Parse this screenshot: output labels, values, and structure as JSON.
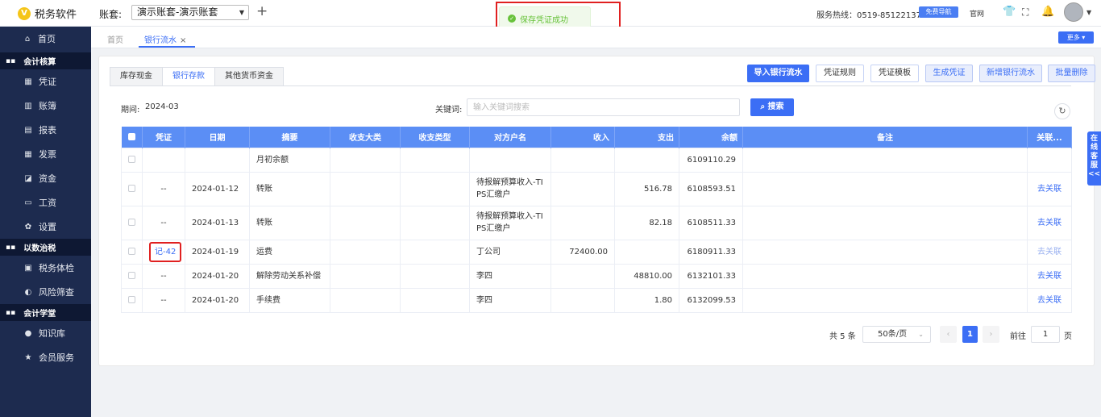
{
  "app": {
    "name": "税务软件",
    "logo_letter": "V"
  },
  "account": {
    "label": "账套:",
    "selected": "演示账套-演示账套"
  },
  "toast": {
    "message": "保存凭证成功"
  },
  "header": {
    "hotline": "服务热线：0519-85122137",
    "free_nav_label": "免费导航",
    "website_label": "官网"
  },
  "sidebar": {
    "items": [
      {
        "type": "item",
        "label": "首页",
        "icon": "home-icon",
        "glyph": "⌂"
      },
      {
        "type": "group",
        "label": "会计核算",
        "icon": "grid-icon",
        "glyph": "▪▪"
      },
      {
        "type": "item",
        "label": "凭证",
        "icon": "voucher-icon",
        "glyph": "▦"
      },
      {
        "type": "item",
        "label": "账簿",
        "icon": "ledger-icon",
        "glyph": "▥"
      },
      {
        "type": "item",
        "label": "报表",
        "icon": "report-icon",
        "glyph": "▤"
      },
      {
        "type": "item",
        "label": "发票",
        "icon": "invoice-icon",
        "glyph": "▦"
      },
      {
        "type": "item",
        "label": "资金",
        "icon": "fund-icon",
        "glyph": "◪"
      },
      {
        "type": "item",
        "label": "工资",
        "icon": "salary-icon",
        "glyph": "▭"
      },
      {
        "type": "item",
        "label": "设置",
        "icon": "settings-icon",
        "glyph": "✿"
      },
      {
        "type": "group",
        "label": "以数治税",
        "icon": "grid-icon",
        "glyph": "▪▪"
      },
      {
        "type": "item",
        "label": "税务体检",
        "icon": "tax-check-icon",
        "glyph": "▣"
      },
      {
        "type": "item",
        "label": "风险筛查",
        "icon": "risk-icon",
        "glyph": "◐"
      },
      {
        "type": "group",
        "label": "会计学堂",
        "icon": "grid-icon",
        "glyph": "▪▪"
      },
      {
        "type": "item",
        "label": "知识库",
        "icon": "knowledge-icon",
        "glyph": "●"
      },
      {
        "type": "item",
        "label": "会员服务",
        "icon": "member-icon",
        "glyph": "★"
      }
    ]
  },
  "tabs": {
    "home": "首页",
    "current": "银行流水",
    "more": "更多"
  },
  "subtabs": [
    "库存现金",
    "银行存款",
    "其他货币资金"
  ],
  "actions": {
    "import": "导入银行流水",
    "voucher_rules": "凭证规则",
    "voucher_template": "凭证模板",
    "generate": "生成凭证",
    "add_bank": "新增银行流水",
    "batch_delete": "批量删除"
  },
  "filters": {
    "period_label": "期间:",
    "period": "2024-03",
    "keyword_label": "关键词:",
    "keyword_placeholder": "输入关键词搜索",
    "search_label": "搜索"
  },
  "table": {
    "columns": [
      "凭证",
      "日期",
      "摘要",
      "收支大类",
      "收支类型",
      "对方户名",
      "收入",
      "支出",
      "余额",
      "备注",
      "关联..."
    ],
    "rows": [
      {
        "voucher": "",
        "date": "",
        "summary": "月初余额",
        "major": "",
        "type": "",
        "party": "",
        "income": "",
        "expense": "",
        "balance": "6109110.29",
        "remark": "",
        "link": ""
      },
      {
        "voucher": "--",
        "date": "2024-01-12",
        "summary": "转账",
        "major": "",
        "type": "",
        "party": "待报解预算收入-TIPS汇缴户",
        "income": "",
        "expense": "516.78",
        "balance": "6108593.51",
        "remark": "",
        "link": "去关联"
      },
      {
        "voucher": "--",
        "date": "2024-01-13",
        "summary": "转账",
        "major": "",
        "type": "",
        "party": "待报解预算收入-TIPS汇缴户",
        "income": "",
        "expense": "82.18",
        "balance": "6108511.33",
        "remark": "",
        "link": "去关联"
      },
      {
        "voucher": "记-42",
        "date": "2024-01-19",
        "summary": "运费",
        "major": "",
        "type": "",
        "party": "丁公司",
        "income": "72400.00",
        "expense": "",
        "balance": "6180911.33",
        "remark": "",
        "link": "去关联"
      },
      {
        "voucher": "--",
        "date": "2024-01-20",
        "summary": "解除劳动关系补偿",
        "major": "",
        "type": "",
        "party": "李四",
        "income": "",
        "expense": "48810.00",
        "balance": "6132101.33",
        "remark": "",
        "link": "去关联"
      },
      {
        "voucher": "--",
        "date": "2024-01-20",
        "summary": "手续费",
        "major": "",
        "type": "",
        "party": "李四",
        "income": "",
        "expense": "1.80",
        "balance": "6132099.53",
        "remark": "",
        "link": "去关联"
      }
    ]
  },
  "pagination": {
    "total": "共 5 条",
    "page_size": "50条/页",
    "current_page": "1",
    "goto_label": "前往",
    "goto_value": "1",
    "page_suffix": "页"
  },
  "side_service": "在线客服<<"
}
